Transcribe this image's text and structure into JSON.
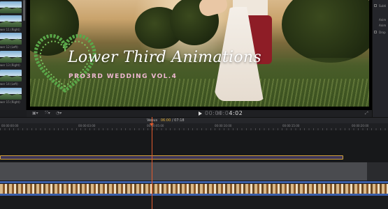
{
  "browser": {
    "clips": [
      {
        "label": ""
      },
      {
        "label": "wer 11 (Right)"
      },
      {
        "label": "wer 12 (Left)"
      },
      {
        "label": "wer 13 (Right)"
      },
      {
        "label": "wer 14 (Left)"
      },
      {
        "label": "wer 15 (Right)"
      }
    ]
  },
  "viewer": {
    "title": "Lower Third Animations",
    "subtitle": "PRO3RD WEDDING VOL.4",
    "timecode_dim": "00:00:0",
    "timecode": "4:02",
    "zoom_icon": "zoom-icon",
    "colors": {
      "title": "#ffffff",
      "subtitle": "#f0b9d2",
      "heart": "#5aa84a"
    }
  },
  "inspector": {
    "labels": [
      "Subti",
      "Anim",
      "Anim",
      "Drop",
      ""
    ]
  },
  "timeline": {
    "project_name": "Venus",
    "current_time": "06:00",
    "duration": "07:18",
    "ruler_ticks": [
      "00:00:00:00",
      "00:00:03:00",
      "00:00:05:00",
      "00:00:10:00",
      "00:00:15:00",
      "00:00:20:00",
      "00:00:25:00"
    ],
    "colors": {
      "playhead": "#e35b2e",
      "title_clip_border": "#d6a43a",
      "track_blue": "#3a5ea8"
    }
  }
}
